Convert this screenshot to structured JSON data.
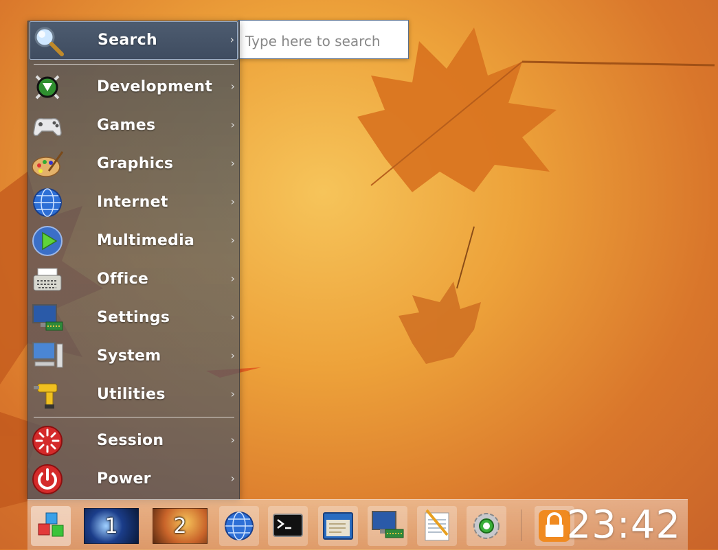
{
  "menu": {
    "search": {
      "label": "Search",
      "placeholder": "Type here to search"
    },
    "items": [
      {
        "label": "Development",
        "icon": "development-icon"
      },
      {
        "label": "Games",
        "icon": "gamepad-icon"
      },
      {
        "label": "Graphics",
        "icon": "palette-icon"
      },
      {
        "label": "Internet",
        "icon": "globe-icon"
      },
      {
        "label": "Multimedia",
        "icon": "play-icon"
      },
      {
        "label": "Office",
        "icon": "typewriter-icon"
      },
      {
        "label": "Settings",
        "icon": "monitor-settings-icon"
      },
      {
        "label": "System",
        "icon": "computer-icon"
      },
      {
        "label": "Utilities",
        "icon": "drill-icon"
      }
    ],
    "session": {
      "label": "Session",
      "icon": "session-icon"
    },
    "power": {
      "label": "Power",
      "icon": "power-icon"
    },
    "arrow": "›"
  },
  "taskbar": {
    "desktops": [
      "1",
      "2"
    ],
    "clock": "23:42",
    "launchers": [
      "browser-icon",
      "terminal-icon",
      "file-manager-icon",
      "system-monitor-icon",
      "text-editor-icon",
      "settings-gear-icon"
    ]
  },
  "colors": {
    "menu_bg": "#4f5763",
    "active": "#3f4c60",
    "accent": "#9fb2cc"
  }
}
